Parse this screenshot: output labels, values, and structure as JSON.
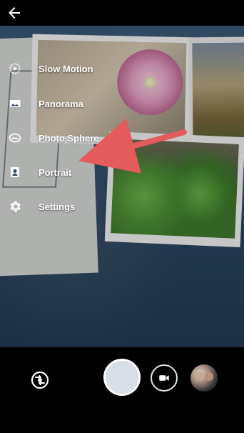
{
  "menu": {
    "items": [
      {
        "label": "Slow Motion",
        "icon": "slow-motion-icon"
      },
      {
        "label": "Panorama",
        "icon": "panorama-icon"
      },
      {
        "label": "Photo Sphere",
        "icon": "photo-sphere-icon"
      },
      {
        "label": "Portrait",
        "icon": "portrait-icon"
      },
      {
        "label": "Settings",
        "icon": "settings-icon"
      }
    ]
  },
  "colors": {
    "annotation_arrow": "#e35b5b",
    "shutter_fill": "#d7dee6"
  },
  "controls": {
    "back_icon": "back-arrow-icon",
    "switch_camera_icon": "switch-camera-icon",
    "video_icon": "video-camera-icon",
    "gallery_thumbnail": "gallery-thumbnail"
  }
}
